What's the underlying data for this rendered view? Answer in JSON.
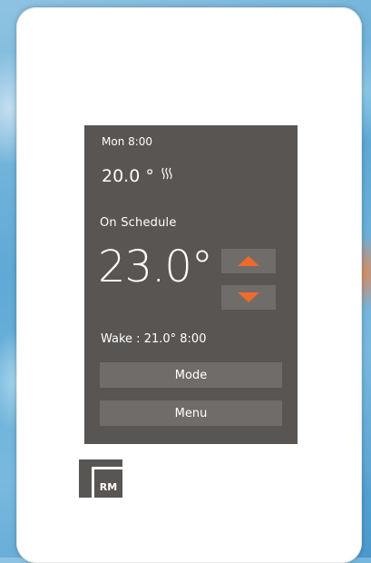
{
  "screen": {
    "day_time": "Mon 8:00",
    "current_temp": "20.0 °",
    "heating_icon": "heating-waves-icon",
    "status": "On Schedule",
    "setpoint": "23.0°",
    "up_icon": "arrow-up-icon",
    "down_icon": "arrow-down-icon",
    "next_event": "Wake : 21.0° 8:00",
    "mode_label": "Mode",
    "menu_label": "Menu"
  },
  "brand": {
    "logo_text": "RM",
    "logo_color": "#585553"
  },
  "colors": {
    "screen_bg": "#585553",
    "button_bg": "#706c6a",
    "accent": "#ee6a2c",
    "text": "#ffffff"
  }
}
